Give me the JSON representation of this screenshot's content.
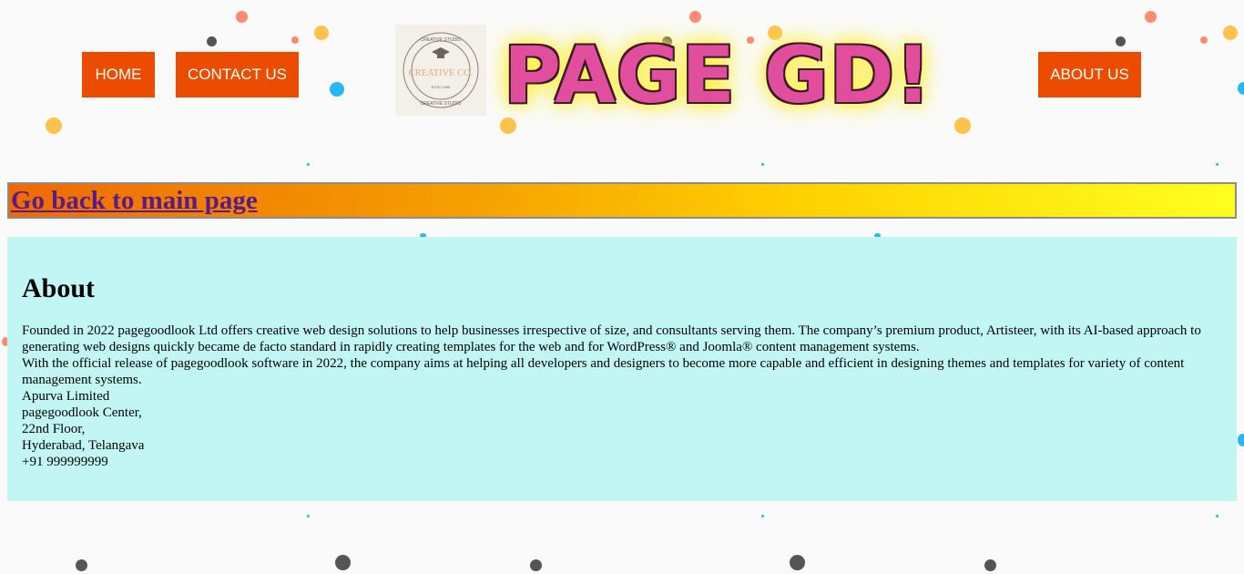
{
  "nav": {
    "home_label": "HOME",
    "contact_label": "CONTACT US",
    "about_label": "ABOUT US"
  },
  "logo": {
    "text": "CREATIVE CO.",
    "ring_top": "CREATIVE STUDIO",
    "ring_bottom": "CREATIVE STUDIO",
    "est": "ESTD 1995"
  },
  "header": {
    "title": "PAGE GD!"
  },
  "back_link": {
    "label": "Go back to main page"
  },
  "about": {
    "heading": "About",
    "lines": [
      "Founded in 2022 pagegoodlook Ltd offers creative web design solutions to help businesses irrespective of size, and consultants serving them. The company’s premium product, Artisteer, with its AI-based approach to generating web designs quickly became de facto standard in rapidly creating templates for the web and for WordPress® and Joomla® content management systems.",
      "With the official release of pagegoodlook software in 2022, the company aims at helping all developers and designers to become more capable and efficient in designing themes and templates for variety of content management systems.",
      "Apurva Limited",
      "pagegoodlook Center,",
      "22nd Floor,",
      "Hyderabad, Telangava",
      "+91 999999999"
    ]
  },
  "colors": {
    "nav_button": "#ec4c00",
    "title_fill": "#e14e9e",
    "about_bg": "#c1f6f5",
    "link": "#5a1a8c"
  }
}
